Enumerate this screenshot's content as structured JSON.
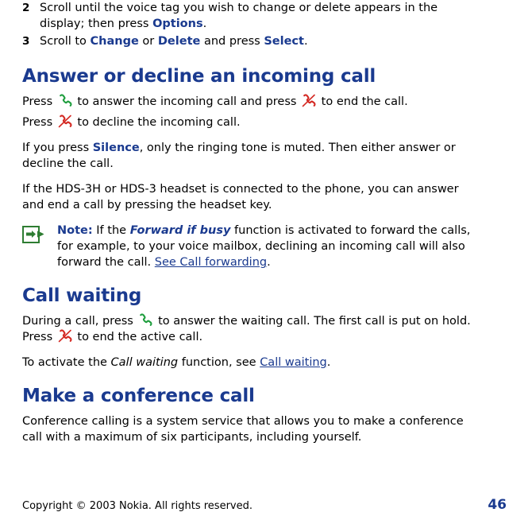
{
  "steps": [
    {
      "num": "2",
      "text_pre": "Scroll until the voice tag you wish to change or delete appears in the display; then press ",
      "bold": "Options",
      "text_post": "."
    }
  ],
  "step3": {
    "num": "3",
    "pre": "Scroll to ",
    "b1": "Change",
    "mid": " or ",
    "b2": "Delete",
    "mid2": " and press ",
    "b3": "Select",
    "post": "."
  },
  "sections": {
    "answer_decline": {
      "heading": "Answer or decline an incoming call",
      "p1_a": "Press ",
      "p1_b": " to answer the incoming call and press ",
      "p1_c": " to end the call.",
      "p2_a": "Press ",
      "p2_b": " to decline the incoming call.",
      "p3_a": "If you press ",
      "p3_bold": "Silence",
      "p3_b": ", only the ringing tone is muted. Then either answer or decline the call.",
      "p4": "If the HDS-3H or HDS-3 headset is connected to the phone, you can answer and end a call by pressing the headset key.",
      "note": {
        "label": "Note:",
        "a": " If the ",
        "italic": "Forward if busy",
        "b": " function is activated to forward the calls, for example, to your voice mailbox, declining an incoming call will also forward the call. ",
        "link": "See Call forwarding",
        "c": "."
      }
    },
    "call_waiting": {
      "heading": "Call waiting",
      "p1_a": "During a call, press ",
      "p1_b": " to answer the waiting call. The first call is put on hold. Press ",
      "p1_c": " to end the active call.",
      "p2_a": "To activate the ",
      "p2_italic": "Call waiting",
      "p2_b": " function, see ",
      "p2_link": "Call waiting",
      "p2_c": "."
    },
    "conference": {
      "heading": "Make a conference call",
      "p1": "Conference calling is a system service that allows you to make a conference call with a maximum of six participants, including yourself."
    }
  },
  "footer": {
    "copyright": "Copyright © 2003 Nokia. All rights reserved.",
    "page_number": "46"
  },
  "colors": {
    "heading_blue": "#1a3a8f",
    "link_blue": "#1a3a8f",
    "answer_key_green": "#1f9e3e",
    "end_key_red": "#d42a24",
    "note_icon_green": "#2e7d32"
  },
  "icons": {
    "answer_key": "green-call-key-icon",
    "end_key": "red-end-call-key-icon",
    "note": "note-pointing-hand-icon"
  }
}
